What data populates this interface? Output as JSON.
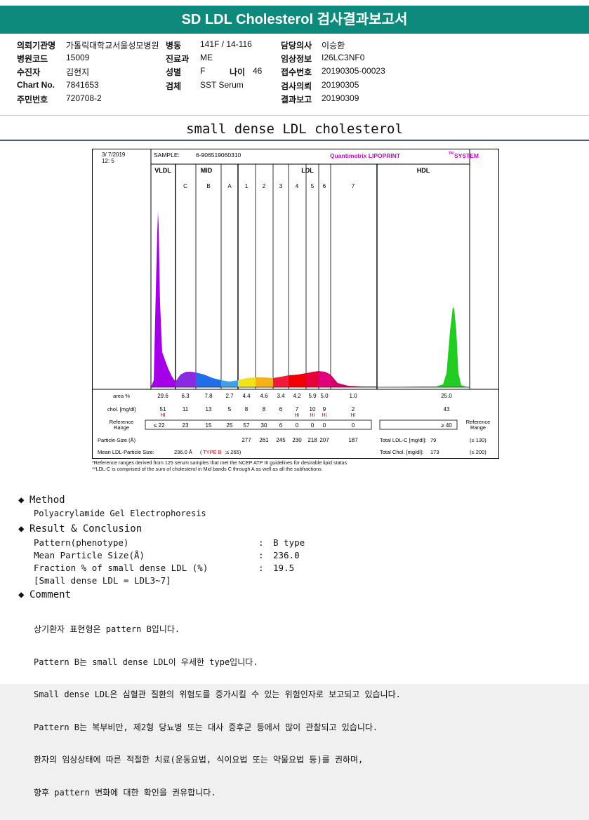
{
  "title": "SD LDL Cholesterol 검사결과보고서",
  "info": {
    "hospital_label": "의뢰기관명",
    "hospital": "가톨릭대학교서울성모병원",
    "ward_label": "병동",
    "ward": "141F / 14-116",
    "doctor_label": "담당의사",
    "doctor": "이승환",
    "hospcode_label": "병원코드",
    "hospcode": "15009",
    "dept_label": "진료과",
    "dept": "ME",
    "clinical_label": "임상정보",
    "clinical": "I26LC3NF0",
    "patient_label": "수진자",
    "patient": "김현지",
    "sex_label": "성별",
    "sex": "F",
    "age_label": "나이",
    "age": "46",
    "receipt_label": "접수번호",
    "receipt": "20190305-00023",
    "chart_label": "Chart No.",
    "chart": "7841653",
    "specimen_label": "검체",
    "specimen": "SST Serum",
    "request_label": "검사의뢰",
    "request": "20190305",
    "resident_label": "주민번호",
    "resident": "720708-2",
    "report_label": "결과보고",
    "report": "20190309"
  },
  "subtitle": "small dense LDL cholesterol",
  "chart_data": {
    "type": "area",
    "date": "3/ 7/2019",
    "time": "12: 5",
    "sample_label": "SAMPLE:",
    "sample": "6-906519060310",
    "brand": "Quantimetrix LIPOPRINT",
    "brand_sup": "TM",
    "brand_tail": "SYSTEM",
    "groups": {
      "vldl": "VLDL",
      "mid": "MID",
      "ldl": "LDL",
      "hdl": "HDL"
    },
    "bands": [
      "C",
      "B",
      "A",
      "1",
      "2",
      "3",
      "4",
      "5",
      "6",
      "7"
    ],
    "row_labels": {
      "area": "area %",
      "chol": "chol. [mg/dl]",
      "ref1": "Reference",
      "ref2": "Range",
      "size": "Particle-Size (Å)",
      "mean": "Mean LDL-Particle Size:"
    },
    "area": [
      "29.6",
      "6.3",
      "7.8",
      "2.7",
      "4.4",
      "4.6",
      "3.4",
      "4.2",
      "5.9",
      "5.0",
      "1.0",
      "25.0"
    ],
    "chol": [
      "51",
      "11",
      "13",
      "5",
      "8",
      "8",
      "6",
      "7",
      "10",
      "9",
      "2",
      "43"
    ],
    "chol_hi": [
      true,
      false,
      false,
      false,
      false,
      false,
      false,
      true,
      true,
      true,
      true,
      false
    ],
    "hi_text": "HI",
    "ref": [
      "≤ 22",
      "23",
      "15",
      "25",
      "57",
      "30",
      "6",
      "0",
      "0",
      "0",
      "0",
      "≥ 40"
    ],
    "size": [
      "277",
      "261",
      "245",
      "230",
      "218",
      "207",
      "187"
    ],
    "mean_value": "236.0 Å",
    "mean_type_open": "(",
    "mean_type": "TYPE B",
    "mean_type_close": ";≤ 265)",
    "total_ldl_label": "Total LDL-C [mg/dl]:",
    "total_ldl": "79",
    "total_ldl_ref": "(≤ 130)",
    "total_chol_label": "Total Chol. [mg/dl]:",
    "total_chol": "173",
    "total_chol_ref": "(≤ 200)",
    "right_ref1": "Reference",
    "right_ref2": "Range",
    "colors": {
      "vldl": "#a400e8",
      "c": "#8a2be2",
      "b": "#1e6ee8",
      "a": "#3fa0e8",
      "l1": "#f2e21a",
      "l2": "#f5b01a",
      "l3": "#f01a3a",
      "l4": "#f00000",
      "l5": "#e8003a",
      "l6": "#e0007a",
      "l7": "#d4006a",
      "hdl": "#22cc22"
    }
  },
  "footnotes": [
    "*Reference ranges derived from 125 serum samples that met the NCEP ATP III guidelines for desirable lipid status",
    "**LDL-C is comprised of the sum of cholesterol in Mid bands C through A as well as all the subfractions"
  ],
  "method": {
    "heading": "Method",
    "text": "Polyacrylamide Gel Electrophoresis"
  },
  "result": {
    "heading": "Result & Conclusion",
    "rows": [
      {
        "k": "Pattern(phenotype)",
        "v": "B type"
      },
      {
        "k": "Mean Particle Size(Å)",
        "v": "236.0"
      },
      {
        "k": "Fraction % of small dense LDL (%)",
        "v": "19.5"
      }
    ],
    "sep": ":",
    "note": "[Small dense LDL = LDL3~7]"
  },
  "comment": {
    "heading": "Comment",
    "lines": [
      "상기환자 표현형은 pattern B입니다.",
      "Pattern B는 small dense LDL이 우세한 type입니다.",
      "Small dense LDL은 심혈관 질환의 위험도를 증가시킬 수 있는 위험인자로 보고되고 있습니다.",
      "Pattern B는 복부비만, 제2형 당뇨병 또는 대사 증후군 등에서 많이 관찰되고 있습니다.",
      "환자의 임상상태에 따른 적절한 치료(운동요법, 식이요법 또는 약물요법 등)를 권하며,",
      "향후 pattern 변화에 대한 확인을 권유합니다."
    ]
  }
}
